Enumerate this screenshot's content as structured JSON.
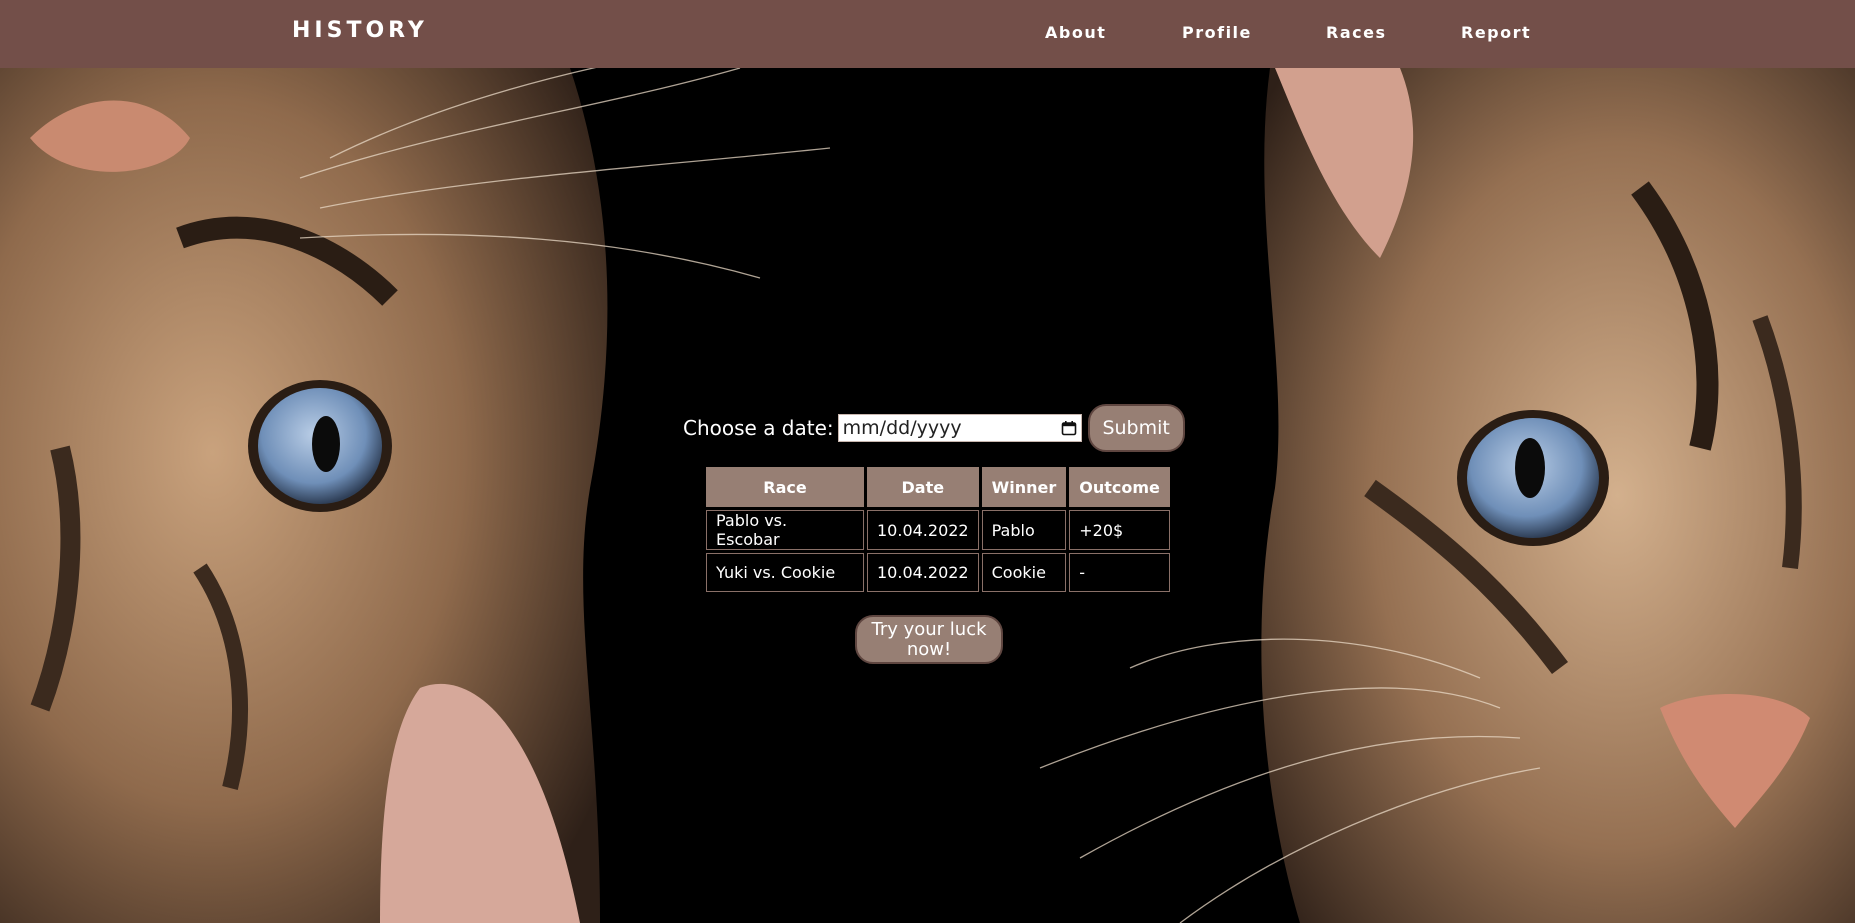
{
  "header": {
    "brand": "HISTORY",
    "nav": [
      "About",
      "Profile",
      "Races",
      "Report"
    ]
  },
  "form": {
    "label": "Choose a date:",
    "date_placeholder": "mm/dd/yyyy",
    "submit_label": "Submit"
  },
  "table": {
    "headers": [
      "Race",
      "Date",
      "Winner",
      "Outcome"
    ],
    "rows": [
      [
        "Pablo vs. Escobar",
        "10.04.2022",
        "Pablo",
        "+20$"
      ],
      [
        "Yuki vs. Cookie",
        "10.04.2022",
        "Cookie",
        "-"
      ]
    ]
  },
  "cta": {
    "line1": "Try your luck",
    "line2": "now!"
  },
  "colors": {
    "navbar": "#734f49",
    "button": "#977f74",
    "background": "#000000"
  },
  "background_image": "two tabby kittens with blue eyes on black background"
}
